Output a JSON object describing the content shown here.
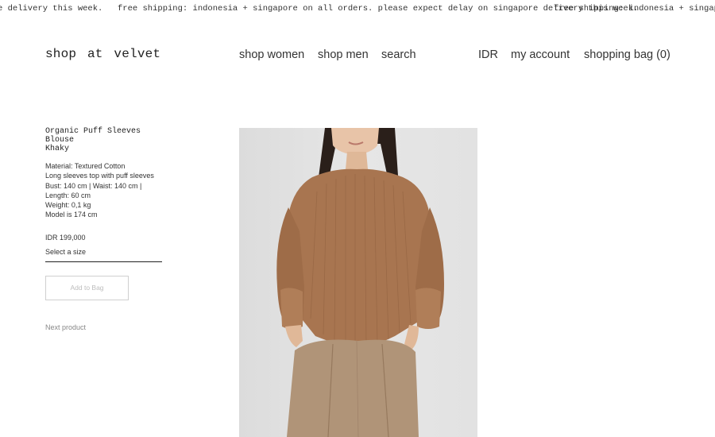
{
  "announcement": {
    "text_partial_left": "e delivery this week.",
    "text": "free shipping: indonesia + singapore on all orders. please expect delay on singapore delivery this week.",
    "text_partial_right": "free shipping: indonesia + singapore on all"
  },
  "header": {
    "logo": "shop at velvet",
    "nav": {
      "shop_women": "shop women",
      "shop_men": "shop men",
      "search": "search"
    },
    "currency": "IDR",
    "account": "my account",
    "bag": "shopping bag (0)"
  },
  "product": {
    "title_line1": "Organic Puff Sleeves Blouse",
    "title_line2": "Khaky",
    "description": [
      "Material: Textured Cotton",
      "Long sleeves top with puff sleeves",
      "Bust: 140 cm | Waist: 140 cm |",
      "Length: 60 cm",
      "Weight: 0,1 kg",
      "Model is 174 cm"
    ],
    "price": "IDR 199,000",
    "size_placeholder": "Select a size",
    "add_to_bag": "Add to Bag",
    "next_product": "Next product"
  },
  "colors": {
    "blouse": "#a87550",
    "trousers": "#b09478",
    "photo_bg": "#e4e4e4",
    "skin": "#e8c4a8",
    "hair": "#2a1f1a"
  }
}
